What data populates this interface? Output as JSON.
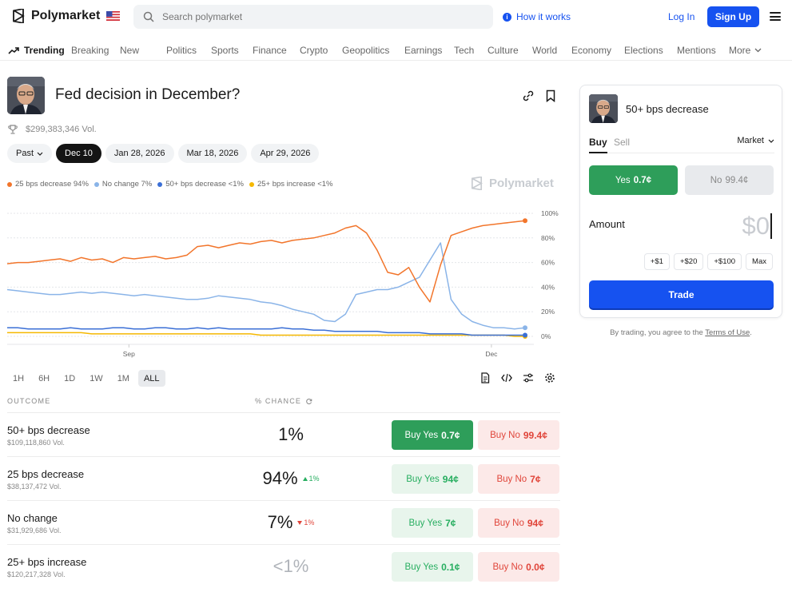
{
  "header": {
    "logo_text": "Polymarket",
    "flag_icon": "us-flag-icon",
    "search_placeholder": "Search polymarket",
    "how_it_works": "How it works",
    "login": "Log In",
    "signup": "Sign Up"
  },
  "nav": {
    "items": [
      "Trending",
      "Breaking",
      "New",
      "Politics",
      "Sports",
      "Finance",
      "Crypto",
      "Geopolitics",
      "Earnings",
      "Tech",
      "Culture",
      "World",
      "Economy",
      "Elections",
      "Mentions",
      "More"
    ],
    "active": "Trending"
  },
  "market": {
    "title": "Fed decision in December?",
    "volume": "$299,383,346 Vol.",
    "date_tabs": [
      "Past",
      "Dec 10",
      "Jan 28, 2026",
      "Mar 18, 2026",
      "Apr 29, 2026"
    ],
    "active_date": "Dec 10",
    "watermark": "Polymarket"
  },
  "chart_data": {
    "type": "line",
    "x_tick_labels": [
      "Sep",
      "Dec"
    ],
    "y_tick_labels": [
      "100%",
      "80%",
      "60%",
      "40%",
      "20%",
      "0%"
    ],
    "ylim": [
      0,
      100
    ],
    "grid": true,
    "legend_position": "top-left",
    "series": [
      {
        "name": "25 bps decrease",
        "legend_label": "25 bps decrease 94%",
        "color": "#f2752b",
        "values": [
          59,
          60,
          60,
          61,
          62,
          63,
          61,
          64,
          62,
          63,
          60,
          64,
          63,
          64,
          65,
          63,
          64,
          66,
          73,
          74,
          72,
          74,
          76,
          75,
          77,
          78,
          76,
          78,
          79,
          80,
          82,
          84,
          88,
          90,
          84,
          70,
          52,
          50,
          56,
          40,
          28,
          58,
          82,
          85,
          88,
          90,
          91,
          92,
          93,
          94
        ]
      },
      {
        "name": "No change",
        "legend_label": "No change 7%",
        "color": "#8ab4e8",
        "values": [
          38,
          37,
          36,
          35,
          34,
          34,
          35,
          36,
          35,
          36,
          35,
          34,
          33,
          34,
          33,
          32,
          31,
          30,
          30,
          31,
          33,
          32,
          31,
          30,
          28,
          27,
          25,
          22,
          20,
          18,
          13,
          12,
          18,
          34,
          36,
          38,
          38,
          40,
          44,
          48,
          62,
          76,
          30,
          18,
          12,
          9,
          7,
          7,
          6,
          7
        ]
      },
      {
        "name": "50+ bps decrease",
        "legend_label": "50+ bps decrease <1%",
        "color": "#3b6fd6",
        "values": [
          7,
          7,
          6,
          6,
          6,
          6,
          7,
          6,
          6,
          6,
          7,
          7,
          6,
          6,
          7,
          7,
          6,
          6,
          7,
          6,
          7,
          6,
          6,
          6,
          6,
          6,
          7,
          6,
          6,
          5,
          5,
          4,
          4,
          4,
          4,
          4,
          3,
          3,
          3,
          3,
          2,
          2,
          2,
          2,
          1,
          1,
          1,
          1,
          1,
          1
        ]
      },
      {
        "name": "25+ bps increase",
        "legend_label": "25+ bps increase <1%",
        "color": "#f5b800",
        "values": [
          3,
          3,
          3,
          3,
          3,
          3,
          3,
          3,
          2,
          2,
          2,
          2,
          2,
          2,
          2,
          2,
          2,
          2,
          2,
          2,
          2,
          2,
          2,
          2,
          1,
          1,
          1,
          1,
          1,
          1,
          1,
          1,
          1,
          1,
          1,
          1,
          1,
          1,
          1,
          1,
          1,
          1,
          1,
          1,
          1,
          1,
          1,
          1,
          0,
          0
        ]
      }
    ]
  },
  "range_tabs": [
    "1H",
    "6H",
    "1D",
    "1W",
    "1M",
    "ALL"
  ],
  "active_range": "ALL",
  "table": {
    "header_outcome": "OUTCOME",
    "header_chance": "% CHANCE",
    "rows": [
      {
        "name": "50+ bps decrease",
        "volume": "$109,118,860 Vol.",
        "chance": "1%",
        "delta": "",
        "yes_label": "Buy Yes",
        "yes_price": "0.7¢",
        "no_label": "Buy No",
        "no_price": "99.4¢"
      },
      {
        "name": "25 bps decrease",
        "volume": "$38,137,472 Vol.",
        "chance": "94%",
        "delta": "1%",
        "yes_label": "Buy Yes",
        "yes_price": "94¢",
        "no_label": "Buy No",
        "no_price": "7¢"
      },
      {
        "name": "No change",
        "volume": "$31,929,686 Vol.",
        "chance": "7%",
        "delta": "1%",
        "yes_label": "Buy Yes",
        "yes_price": "7¢",
        "no_label": "Buy No",
        "no_price": "94¢"
      },
      {
        "name": "25+ bps increase",
        "volume": "$120,217,328 Vol.",
        "chance": "<1%",
        "delta": "",
        "yes_label": "Buy Yes",
        "yes_price": "0.1¢",
        "no_label": "Buy No",
        "no_price": "0.0¢"
      }
    ]
  },
  "trade_panel": {
    "title": "50+ bps decrease",
    "tab_buy": "Buy",
    "tab_sell": "Sell",
    "order_type": "Market",
    "yes_label": "Yes",
    "yes_price": "0.7¢",
    "no_label": "No",
    "no_price": "99.4¢",
    "amount_label": "Amount",
    "amount_value": "$0",
    "quick": [
      "+$1",
      "+$20",
      "+$100",
      "Max"
    ],
    "trade_button": "Trade",
    "terms_prefix": "By trading, you agree to the ",
    "terms_link": "Terms of Use",
    "terms_suffix": "."
  },
  "colors": {
    "brand_blue": "#1652f0",
    "yes_green": "#2e9e5a",
    "no_red": "#e0453a"
  }
}
